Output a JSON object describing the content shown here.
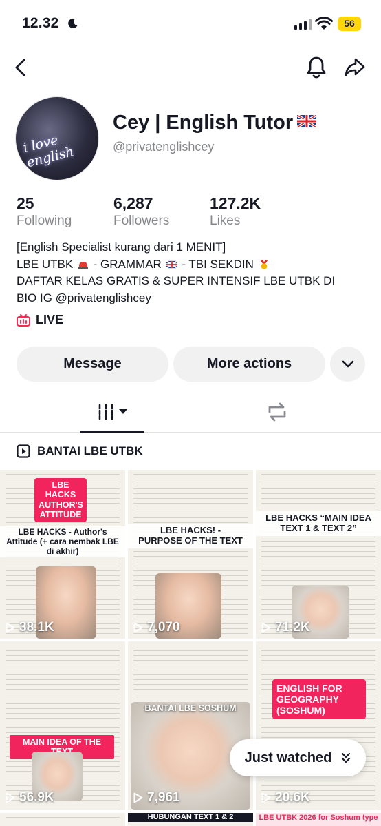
{
  "status_bar": {
    "time": "12.32",
    "battery": "56"
  },
  "profile": {
    "name": "Cey | English Tutor",
    "handle": "@privatenglishcey",
    "avatar_text": "i love english"
  },
  "stats": [
    {
      "value": "25",
      "label": "Following"
    },
    {
      "value": "6,287",
      "label": "Followers"
    },
    {
      "value": "127.2K",
      "label": "Likes"
    }
  ],
  "bio": {
    "line1": "[English Specialist kurang dari 1 MENIT]",
    "line2a": "LBE UTBK",
    "line2b": "- GRAMMAR",
    "line2c": "- TBI SEKDIN",
    "line3": "DAFTAR KELAS GRATIS & SUPER INTENSIF LBE UTBK DI",
    "line4": "BIO IG @privatenglishcey"
  },
  "live_label": "LIVE",
  "actions": {
    "message": "Message",
    "more": "More actions"
  },
  "playlist_title": "BANTAI LBE UTBK",
  "videos": [
    {
      "banner": "LBE HACKS AUTHOR'S ATTITUDE",
      "title": "LBE HACKS - Author's Attitude (+ cara nembak LBE di akhir)",
      "views": "38.1K"
    },
    {
      "banner": "",
      "title": "LBE HACKS! - PURPOSE OF THE TEXT",
      "views": "7,070"
    },
    {
      "banner": "",
      "title": "LBE HACKS “MAIN IDEA TEXT 1 & TEXT 2”",
      "views": "71.2K"
    },
    {
      "banner": "MAIN IDEA OF THE TEXT",
      "title": "",
      "views": "56.9K"
    },
    {
      "banner": "BANTAI LBE SOSHUM",
      "title": "",
      "views": "7,961",
      "footer": "HUBUNGAN TEXT 1 & 2"
    },
    {
      "banner": "ENGLISH FOR GEOGRAPHY (SOSHUM)",
      "title": "",
      "views": "20.6K",
      "footer": "LBE UTBK 2026 for Soshum type"
    }
  ],
  "just_watched": "Just watched",
  "colors": {
    "accent": "#f2245d",
    "live": "#fe2c55",
    "battery": "#ffd60a",
    "muted": "#86878b"
  }
}
